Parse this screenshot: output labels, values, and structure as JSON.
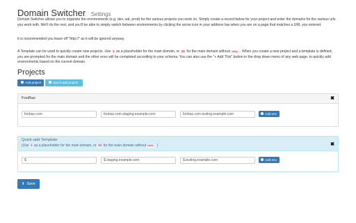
{
  "header": {
    "title": "Domain Switcher",
    "subtitle": "Settings"
  },
  "intro": {
    "p1": "Domain Switcher allows you to organize the environments (e.g. dev, uat, prod) for the various projects you work on. Simply create a record below for your project and enter the domains for the various urls you work with. We'll do the rest, and you'll be able to simply switch between environments by clicking the arrow icon in your address bar when you are on a page that matches a URL you entered.",
    "p2": "It is recommended you leave off \"http://\" as it will be ignored anyway.",
    "p3_a": "A Template can be used to quickly create new projects. Use",
    "p3_code1": "$",
    "p3_b": "as a placeholder for the main domain, or",
    "p3_code2": "$$",
    "p3_c": "for the main domain without",
    "p3_code3": "www.",
    "p3_d": ". When you create a new project and a template is defined, you are prompted for the main domain and the other envs will be completed according to your schema. You can also use the \"+ Add This\" button in the drop down menu of any web page, to quickly add environments based on the current domain."
  },
  "projects": {
    "heading": "Projects",
    "add_project_label": "Add project",
    "quick_add_label": "Quick-add project"
  },
  "project_panel": {
    "title": "FooBaz",
    "close_glyph": "✖",
    "inputs": [
      "foobaz.com",
      "foobaz.com.staging.example.com",
      "foobaz.com.testing.example.com"
    ],
    "add_env_label": "Add env"
  },
  "template_panel": {
    "title": "Quick-add Template",
    "sub_a": "(Use",
    "sub_code1": "$",
    "sub_b": "as a placeholder for the main domain, or",
    "sub_code2": "$$",
    "sub_c": "for the main domain without",
    "sub_code3": "www.",
    "sub_d": ")",
    "close_glyph": "✖",
    "inputs": [
      "$",
      "$.staging.example.com",
      "$.testing.example.com"
    ],
    "add_env_label": "Add env"
  },
  "footer": {
    "save_label": "Save"
  },
  "colors": {
    "primary": "#337ab7",
    "info": "#5bc0de",
    "info_bg": "#d9edf7",
    "code": "#c7254e"
  },
  "icons": {
    "add": "plus-circle-icon",
    "save": "download-icon",
    "close": "close-icon"
  }
}
